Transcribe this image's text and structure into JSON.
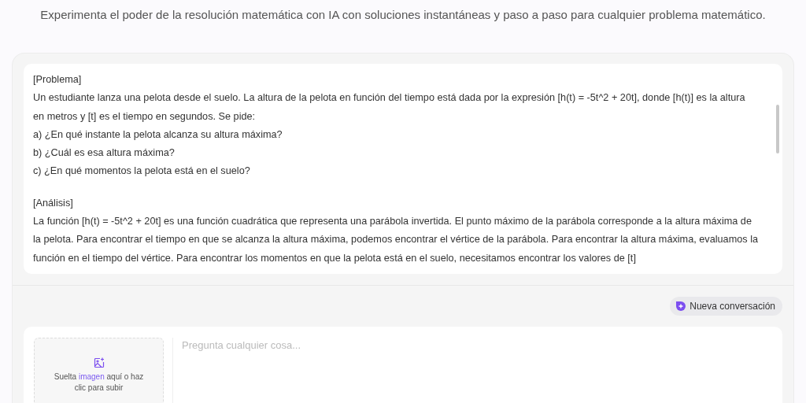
{
  "subtitle": "Experimenta el poder de la resolución matemática con IA con soluciones instantáneas y paso a paso para cualquier problema matemático.",
  "answer": {
    "sections": [
      {
        "heading": "[Problema]",
        "paragraphs": [
          "Un estudiante lanza una pelota desde el suelo. La altura de la pelota en función del tiempo está dada por la expresión [h(t) = -5t^2 + 20t], donde [h(t)] es la altura en metros y [t] es el tiempo en segundos. Se pide:",
          "a) ¿En qué instante la pelota alcanza su altura máxima?",
          "b) ¿Cuál es esa altura máxima?",
          "c) ¿En qué momentos la pelota está en el suelo?"
        ]
      },
      {
        "heading": "[Análisis]",
        "paragraphs": [
          "La función [h(t) = -5t^2 + 20t] es una función cuadrática que representa una parábola invertida. El punto máximo de la parábola corresponde a la altura máxima de la pelota. Para encontrar el tiempo en que se alcanza la altura máxima, podemos encontrar el vértice de la parábola. Para encontrar la altura máxima, evaluamos la función en el tiempo del vértice. Para encontrar los momentos en que la pelota está en el suelo, necesitamos encontrar los valores de [t]"
        ]
      }
    ]
  },
  "new_chat_button": "Nueva conversación",
  "upload": {
    "text": "Suelta *imagen* aquí o haz clic para subir"
  },
  "question_input": {
    "placeholder": "Pregunta cualquier cosa..."
  }
}
